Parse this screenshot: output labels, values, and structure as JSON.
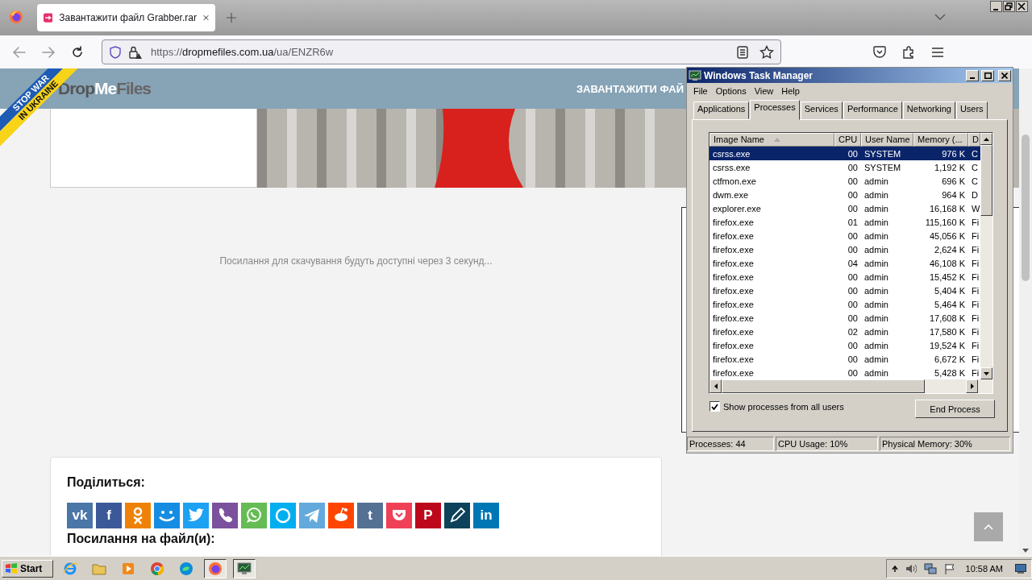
{
  "browser": {
    "tabs": [
      {
        "title": "Завантажити файл Grabber.rar",
        "selected": true
      }
    ],
    "url": {
      "scheme": "https://",
      "host": "dropmefiles.com.ua",
      "path": "/ua/ENZR6w"
    }
  },
  "page": {
    "banner": [
      "STOP WAR",
      "IN UKRAINE"
    ],
    "logo": [
      "Drop",
      "Me",
      "Files"
    ],
    "nav_item": "ЗАВАНТАЖИТИ ФАЙ",
    "countdown": "Посилання для скачування будуть доступні через 3 секунд...",
    "share": {
      "title": "Поділиться:",
      "buttons": [
        {
          "kind": "letter",
          "label": "vk",
          "color": "#4a76a8"
        },
        {
          "kind": "letter",
          "label": "f",
          "color": "#3b5998"
        },
        {
          "kind": "rings",
          "color": "#ee8208"
        },
        {
          "kind": "smile",
          "color": "#168de2"
        },
        {
          "kind": "bird",
          "color": "#1da1f2"
        },
        {
          "kind": "phone",
          "color": "#7b519d"
        },
        {
          "kind": "bubble",
          "color": "#65bc54"
        },
        {
          "kind": "ring",
          "color": "#00aff0"
        },
        {
          "kind": "plane",
          "color": "#64a9dc"
        },
        {
          "kind": "alien",
          "color": "#ff4500"
        },
        {
          "kind": "letter",
          "label": "t",
          "color": "#547093"
        },
        {
          "kind": "pocket",
          "color": "#ef4056"
        },
        {
          "kind": "letter",
          "label": "P",
          "color": "#bd081c"
        },
        {
          "kind": "pencil",
          "color": "#0d425a"
        },
        {
          "kind": "letter",
          "label": "in",
          "color": "#0077b5"
        }
      ]
    },
    "links_title": "Посилання на файл(и):"
  },
  "task_manager": {
    "title": "Windows Task Manager",
    "menu": [
      "File",
      "Options",
      "View",
      "Help"
    ],
    "tabs": [
      {
        "label": "Applications",
        "selected": false
      },
      {
        "label": "Processes",
        "selected": true
      },
      {
        "label": "Services",
        "selected": false
      },
      {
        "label": "Performance",
        "selected": false
      },
      {
        "label": "Networking",
        "selected": false
      },
      {
        "label": "Users",
        "selected": false
      }
    ],
    "columns": [
      "Image Name",
      "CPU",
      "User Name",
      "Memory (...",
      "D"
    ],
    "rows": [
      {
        "cells": [
          "csrss.exe",
          "00",
          "SYSTEM",
          "976 K",
          "C"
        ],
        "selected": true
      },
      {
        "cells": [
          "csrss.exe",
          "00",
          "SYSTEM",
          "1,192 K",
          "C"
        ],
        "selected": false
      },
      {
        "cells": [
          "ctfmon.exe",
          "00",
          "admin",
          "696 K",
          "C"
        ],
        "selected": false
      },
      {
        "cells": [
          "dwm.exe",
          "00",
          "admin",
          "964 K",
          "D"
        ],
        "selected": false
      },
      {
        "cells": [
          "explorer.exe",
          "00",
          "admin",
          "16,168 K",
          "W"
        ],
        "selected": false
      },
      {
        "cells": [
          "firefox.exe",
          "01",
          "admin",
          "115,160 K",
          "Fi"
        ],
        "selected": false
      },
      {
        "cells": [
          "firefox.exe",
          "00",
          "admin",
          "45,056 K",
          "Fi"
        ],
        "selected": false
      },
      {
        "cells": [
          "firefox.exe",
          "00",
          "admin",
          "2,624 K",
          "Fi"
        ],
        "selected": false
      },
      {
        "cells": [
          "firefox.exe",
          "04",
          "admin",
          "46,108 K",
          "Fi"
        ],
        "selected": false
      },
      {
        "cells": [
          "firefox.exe",
          "00",
          "admin",
          "15,452 K",
          "Fi"
        ],
        "selected": false
      },
      {
        "cells": [
          "firefox.exe",
          "00",
          "admin",
          "5,404 K",
          "Fi"
        ],
        "selected": false
      },
      {
        "cells": [
          "firefox.exe",
          "00",
          "admin",
          "5,464 K",
          "Fi"
        ],
        "selected": false
      },
      {
        "cells": [
          "firefox.exe",
          "00",
          "admin",
          "17,608 K",
          "Fi"
        ],
        "selected": false
      },
      {
        "cells": [
          "firefox.exe",
          "02",
          "admin",
          "17,580 K",
          "Fi"
        ],
        "selected": false
      },
      {
        "cells": [
          "firefox.exe",
          "00",
          "admin",
          "19,524 K",
          "Fi"
        ],
        "selected": false
      },
      {
        "cells": [
          "firefox.exe",
          "00",
          "admin",
          "6,672 K",
          "Fi"
        ],
        "selected": false
      },
      {
        "cells": [
          "firefox.exe",
          "00",
          "admin",
          "5,428 K",
          "Fi"
        ],
        "selected": false
      }
    ],
    "show_all_users": {
      "label": "Show processes from all users",
      "checked": true
    },
    "end_button": "End Process",
    "status": [
      "Processes: 44",
      "CPU Usage: 10%",
      "Physical Memory: 30%"
    ]
  },
  "taskbar": {
    "start": "Start",
    "apps": [
      {
        "kind": "ie",
        "active": false
      },
      {
        "kind": "folder",
        "active": false
      },
      {
        "kind": "media",
        "active": false
      },
      {
        "kind": "chrome",
        "active": false
      },
      {
        "kind": "edge",
        "active": false
      },
      {
        "kind": "firefox",
        "active": true
      },
      {
        "kind": "monitor",
        "active": true
      }
    ],
    "clock": "10:58 AM"
  }
}
